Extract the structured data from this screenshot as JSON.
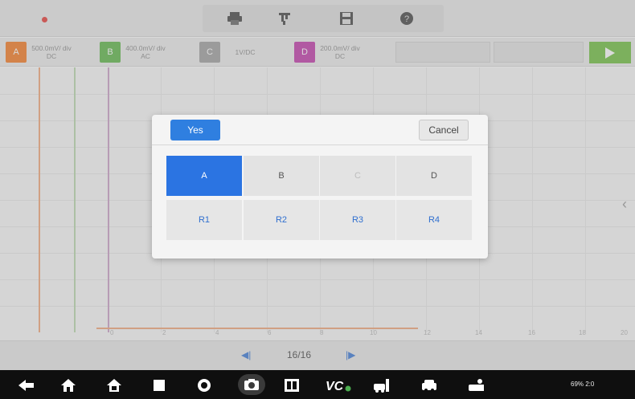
{
  "channels": [
    {
      "letter": "A",
      "scale": "500.0mV/ div DC",
      "color": "#f47a22"
    },
    {
      "letter": "B",
      "scale": "400.0mV/ div AC",
      "color": "#5db548"
    },
    {
      "letter": "C",
      "scale": "1V/DC",
      "color": "#9e9e9e"
    },
    {
      "letter": "D",
      "scale": "200.0mV/ div DC",
      "color": "#c03aa9"
    }
  ],
  "x_axis_labels": [
    "0",
    "2",
    "4",
    "6",
    "8",
    "10",
    "12",
    "14",
    "16",
    "18",
    "20"
  ],
  "pager": {
    "page": "16/16"
  },
  "dialog": {
    "yes_label": "Yes",
    "cancel_label": "Cancel",
    "channel_options": [
      {
        "label": "A",
        "state": "selected"
      },
      {
        "label": "B",
        "state": "enabled"
      },
      {
        "label": "C",
        "state": "disabled"
      },
      {
        "label": "D",
        "state": "enabled"
      }
    ],
    "reference_options": [
      "R1",
      "R2",
      "R3",
      "R4"
    ]
  },
  "status_bar": {
    "text": "69% 2:0"
  },
  "colors": {
    "accent": "#2b74e2",
    "play": "#6fbf3f"
  },
  "icons": {
    "toolbar": [
      "print-icon",
      "settings-icon",
      "save-icon",
      "help-icon"
    ],
    "system_bar": [
      "back-icon",
      "home-icon",
      "house-icon",
      "recents-icon",
      "browser-icon",
      "camera-icon",
      "vci-icon",
      "vc-icon",
      "car-repair-icon",
      "car-icon",
      "person-car-icon"
    ]
  }
}
